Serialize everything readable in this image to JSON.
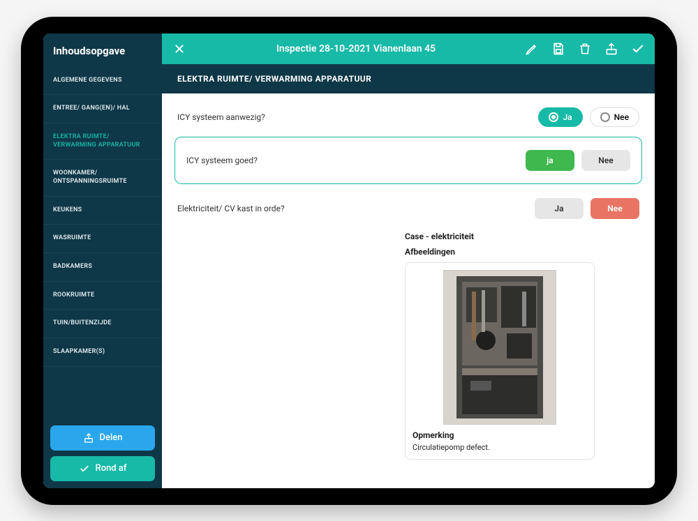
{
  "sidebar": {
    "title": "Inhoudsopgave",
    "items": [
      "ALGEMENE GEGEVENS",
      "ENTREE/ GANG(EN)/ HAL",
      "ELEKTRA RUIMTE/ VERWARMING APPARATUUR",
      "WOONKAMER/ ONTSPANNINGSRUIMTE",
      "KEUKENS",
      "WASRUIMTE",
      "BADKAMERS",
      "ROOKRUIMTE",
      "TUIN/BUITENZIJDE",
      "SLAAPKAMER(S)"
    ],
    "share_label": "Delen",
    "complete_label": "Rond af"
  },
  "header": {
    "title": "Inspectie 28-10-2021 Vianenlaan 45"
  },
  "section": {
    "title": "ELEKTRA RUIMTE/ VERWARMING APPARATUUR"
  },
  "questions": {
    "q1": {
      "label": "ICY systeem aanwezig?",
      "yes": "Ja",
      "no": "Nee"
    },
    "q2": {
      "label": "ICY systeem goed?",
      "yes": "ja",
      "no": "Nee"
    },
    "q3": {
      "label": "Elektriciteit/ CV kast in orde?",
      "yes": "Ja",
      "no": "Nee"
    }
  },
  "case": {
    "title": "Case - elektriciteit",
    "images_label": "Afbeeldingen",
    "note_label": "Opmerking",
    "note": "Circulatiepomp defect."
  }
}
